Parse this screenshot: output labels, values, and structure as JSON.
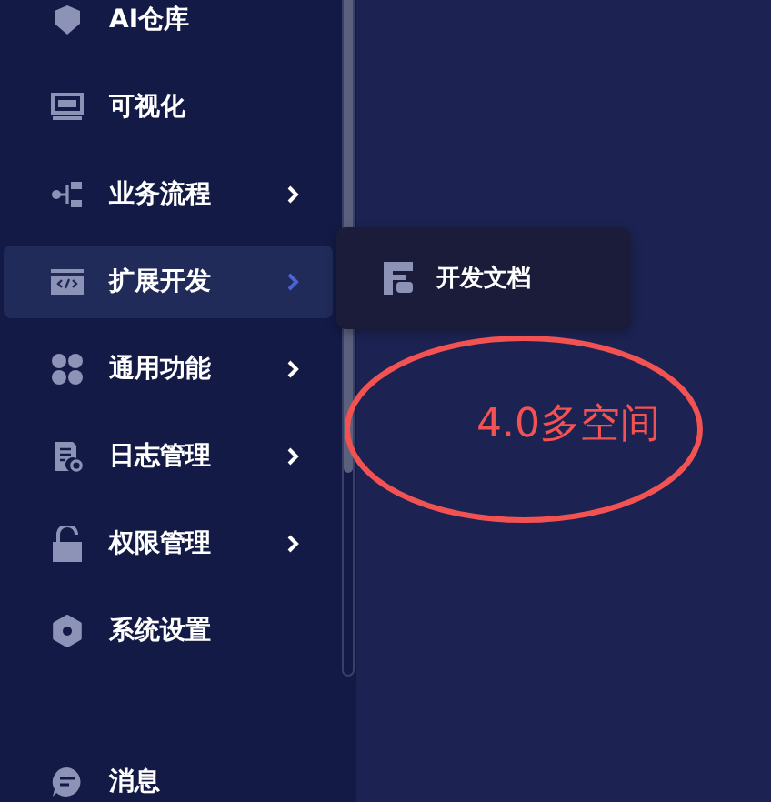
{
  "sidebar": {
    "items": [
      {
        "label": "AI仓库",
        "has_submenu": false,
        "selected": false
      },
      {
        "label": "可视化",
        "has_submenu": false,
        "selected": false
      },
      {
        "label": "业务流程",
        "has_submenu": true,
        "selected": false
      },
      {
        "label": "扩展开发",
        "has_submenu": true,
        "selected": true
      },
      {
        "label": "通用功能",
        "has_submenu": true,
        "selected": false
      },
      {
        "label": "日志管理",
        "has_submenu": true,
        "selected": false
      },
      {
        "label": "权限管理",
        "has_submenu": true,
        "selected": false
      },
      {
        "label": "系统设置",
        "has_submenu": false,
        "selected": false
      }
    ],
    "footer_item": {
      "label": "消息"
    }
  },
  "submenu": {
    "items": [
      {
        "label": "开发文档"
      }
    ]
  },
  "annotation": {
    "text": "4.0多空间"
  }
}
